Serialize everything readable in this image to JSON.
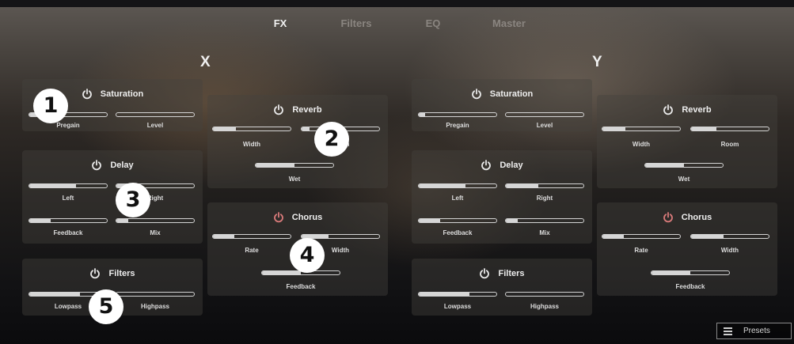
{
  "tabs": [
    {
      "label": "FX",
      "active": true
    },
    {
      "label": "Filters",
      "active": false
    },
    {
      "label": "EQ",
      "active": false
    },
    {
      "label": "Master",
      "active": false
    }
  ],
  "sides": {
    "x_label": "X",
    "y_label": "Y"
  },
  "x": {
    "saturation": {
      "title": "Saturation",
      "power_color": "#e8e8e8",
      "sliders": [
        {
          "label": "Pregain",
          "value": 0.2
        },
        {
          "label": "Level",
          "value": 0
        }
      ]
    },
    "delay": {
      "title": "Delay",
      "power_color": "#e8e8e8",
      "sliders": [
        {
          "label": "Left",
          "value": 0.6
        },
        {
          "label": "Right",
          "value": 0.15
        },
        {
          "label": "Feedback",
          "value": 0.28
        },
        {
          "label": "Mix",
          "value": 0.15
        }
      ]
    },
    "filters": {
      "title": "Filters",
      "power_color": "#e8e8e8",
      "sliders": [
        {
          "label": "Lowpass",
          "value": 0.65
        },
        {
          "label": "Highpass",
          "value": 0
        }
      ]
    },
    "reverb": {
      "title": "Reverb",
      "power_color": "#e8e8e8",
      "sliders": [
        {
          "label": "Width",
          "value": 0.3
        },
        {
          "label": "Room",
          "value": 0.1
        },
        {
          "label": "Wet",
          "value": 0.5
        }
      ]
    },
    "chorus": {
      "title": "Chorus",
      "power_color": "#d97a7a",
      "sliders": [
        {
          "label": "Rate",
          "value": 0.28
        },
        {
          "label": "Width",
          "value": 0.35
        },
        {
          "label": "Feedback",
          "value": 0.5
        }
      ]
    }
  },
  "y": {
    "saturation": {
      "title": "Saturation",
      "power_color": "#e8e8e8",
      "sliders": [
        {
          "label": "Pregain",
          "value": 0.08
        },
        {
          "label": "Level",
          "value": 0
        }
      ]
    },
    "delay": {
      "title": "Delay",
      "power_color": "#e8e8e8",
      "sliders": [
        {
          "label": "Left",
          "value": 0.6
        },
        {
          "label": "Right",
          "value": 0.42
        },
        {
          "label": "Feedback",
          "value": 0.28
        },
        {
          "label": "Mix",
          "value": 0.15
        }
      ]
    },
    "filters": {
      "title": "Filters",
      "power_color": "#e8e8e8",
      "sliders": [
        {
          "label": "Lowpass",
          "value": 0.65
        },
        {
          "label": "Highpass",
          "value": 0
        }
      ]
    },
    "reverb": {
      "title": "Reverb",
      "power_color": "#e8e8e8",
      "sliders": [
        {
          "label": "Width",
          "value": 0.3
        },
        {
          "label": "Room",
          "value": 0.33
        },
        {
          "label": "Wet",
          "value": 0.5
        }
      ]
    },
    "chorus": {
      "title": "Chorus",
      "power_color": "#d97a7a",
      "sliders": [
        {
          "label": "Rate",
          "value": 0.28
        },
        {
          "label": "Width",
          "value": 0.42
        },
        {
          "label": "Feedback",
          "value": 0.5
        }
      ]
    }
  },
  "markers": [
    "1",
    "2",
    "3",
    "4",
    "5"
  ],
  "presets_label": "Presets"
}
